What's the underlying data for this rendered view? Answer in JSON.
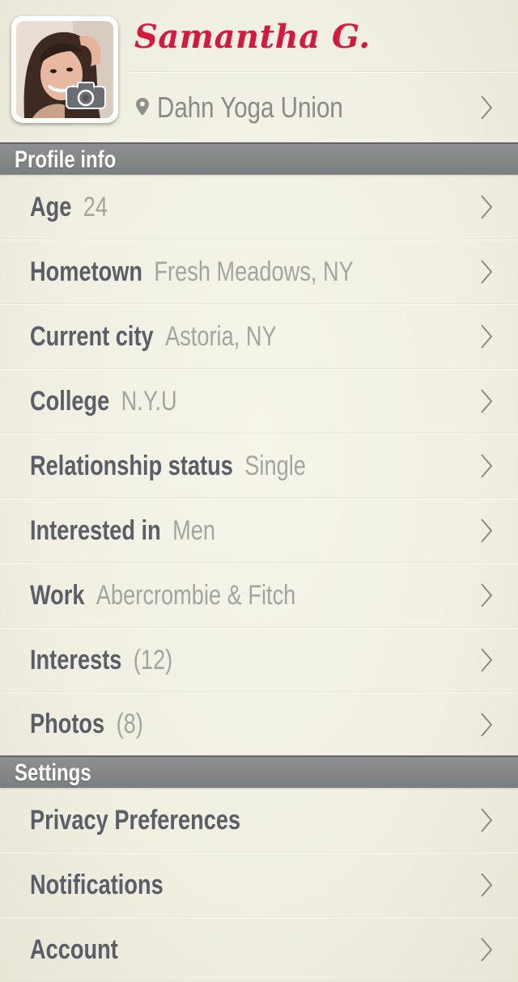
{
  "profile": {
    "name": "Samantha G.",
    "location": "Dahn Yoga Union"
  },
  "sections": {
    "profile_info": "Profile info",
    "settings": "Settings"
  },
  "profile_rows": [
    {
      "label": "Age",
      "value": "24"
    },
    {
      "label": "Hometown",
      "value": "Fresh Meadows, NY"
    },
    {
      "label": "Current city",
      "value": "Astoria, NY"
    },
    {
      "label": "College",
      "value": "N.Y.U"
    },
    {
      "label": "Relationship status",
      "value": "Single"
    },
    {
      "label": "Interested in",
      "value": "Men"
    },
    {
      "label": "Work",
      "value": "Abercrombie & Fitch"
    },
    {
      "label": "Interests",
      "value": "(12)"
    },
    {
      "label": "Photos",
      "value": "(8)"
    }
  ],
  "settings_rows": [
    {
      "label": "Privacy Preferences"
    },
    {
      "label": "Notifications"
    },
    {
      "label": "Account"
    }
  ],
  "colors": {
    "name_accent": "#d6183f",
    "section_header": "#858789",
    "background": "#f1f0e4"
  },
  "icons": {
    "avatar_badge": "camera-icon",
    "location": "map-pin-icon",
    "row_arrow": "chevron-right-icon"
  }
}
